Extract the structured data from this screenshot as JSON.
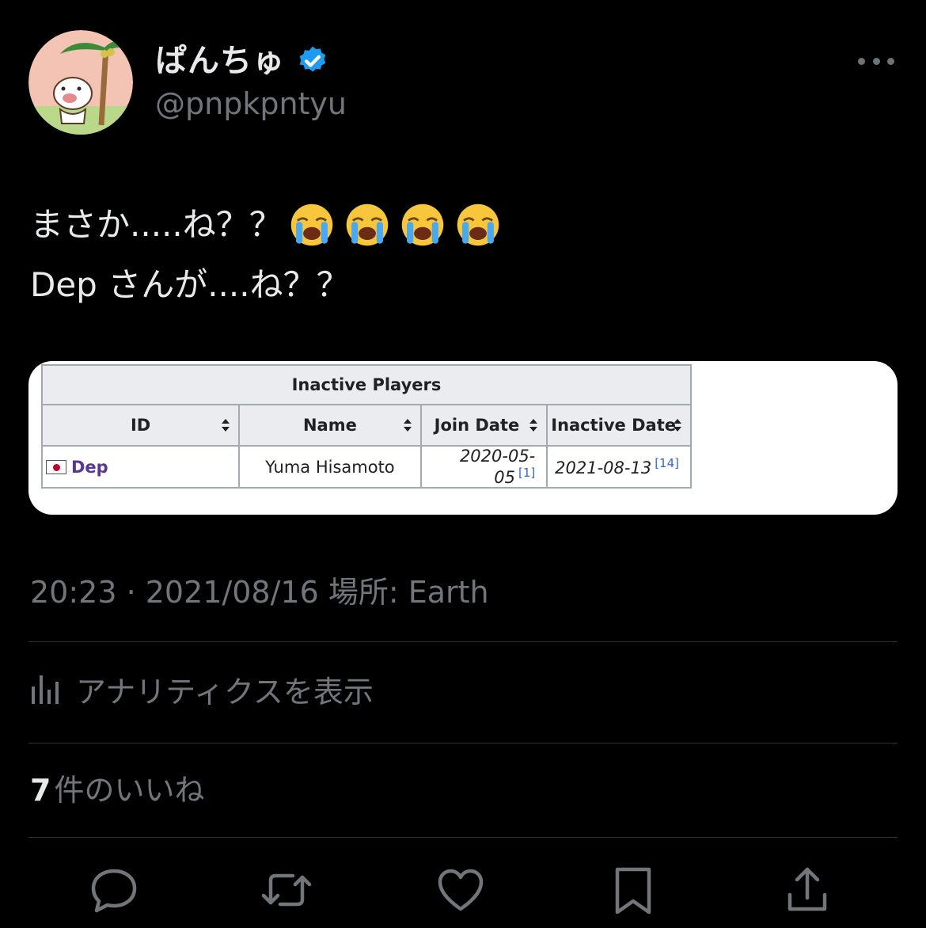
{
  "tweet": {
    "display_name": "ぱんちゅ",
    "handle": "@pnpkpntyu",
    "text_line_1": "まさか.....ね？？",
    "text_line_2": "Dep さんが....ね？？",
    "emoji": [
      "😭",
      "😭",
      "😭",
      "😭"
    ],
    "timestamp": "20:23 · 2021/08/16 場所: Earth",
    "analytics_label": "アナリティクスを表示",
    "likes_count": "7",
    "likes_label": "件のいいね"
  },
  "table": {
    "caption": "Inactive Players",
    "headers": [
      "ID",
      "Name",
      "Join Date",
      "Inactive Date"
    ],
    "row": {
      "id": "Dep",
      "name": "Yuma Hisamoto",
      "join_date": "2020-05-05",
      "join_ref": "[1]",
      "inactive_date": "2021-08-13",
      "inactive_ref": "[14]"
    }
  },
  "icons": {
    "avatar": "panda-pig-avatar",
    "verified": "verified-badge-icon",
    "more": "more-icon",
    "analytics": "bar-chart-icon",
    "actions": [
      "reply-icon",
      "retweet-icon",
      "like-icon",
      "bookmark-icon",
      "share-icon"
    ]
  },
  "colors": {
    "background": "#000000",
    "primary_text": "#e7e9ea",
    "secondary_text": "#71767b",
    "verified_blue": "#1d9bf0",
    "divider": "#2f3336",
    "link_purple": "#5a3696"
  }
}
